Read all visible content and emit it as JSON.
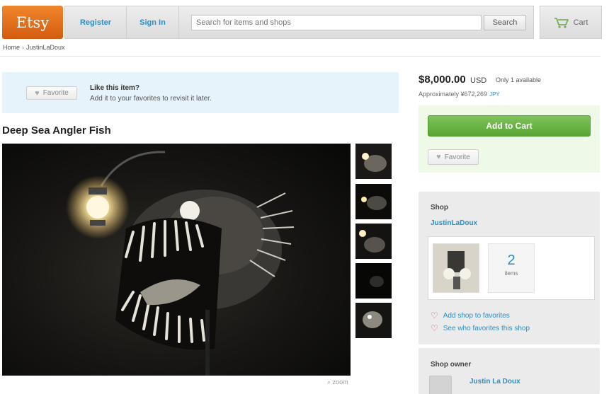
{
  "header": {
    "logo": "Etsy",
    "register": "Register",
    "sign_in": "Sign In",
    "search_placeholder": "Search for items and shops",
    "search_button": "Search",
    "cart": "Cart"
  },
  "breadcrumb": [
    "Home",
    "JustinLaDoux"
  ],
  "favorite_banner": {
    "button": "Favorite",
    "heading": "Like this item?",
    "subtext": "Add it to your favorites to revisit it later."
  },
  "item": {
    "title": "Deep Sea Angler Fish",
    "zoom_label": "zoom"
  },
  "pricing": {
    "price": "$8,000.00",
    "currency": "USD",
    "availability": "Only 1 available",
    "approx": "Approximately ¥672,269",
    "approx_currency": "JPY"
  },
  "buy": {
    "add_to_cart": "Add to Cart",
    "favorite": "Favorite"
  },
  "shop": {
    "label": "Shop",
    "name": "JustinLaDoux",
    "item_count": "2",
    "items_label": "items",
    "add_favorites": "Add shop to favorites",
    "see_favorites": "See who favorites this shop"
  },
  "owner": {
    "label": "Shop owner",
    "name": "Justin La Doux"
  },
  "colors": {
    "etsy_orange": "#e66d1c",
    "link_blue": "#2a8fc4",
    "cart_green": "#6db447"
  },
  "icons": [
    "cart-icon",
    "heart-icon",
    "magnifier-icon"
  ]
}
